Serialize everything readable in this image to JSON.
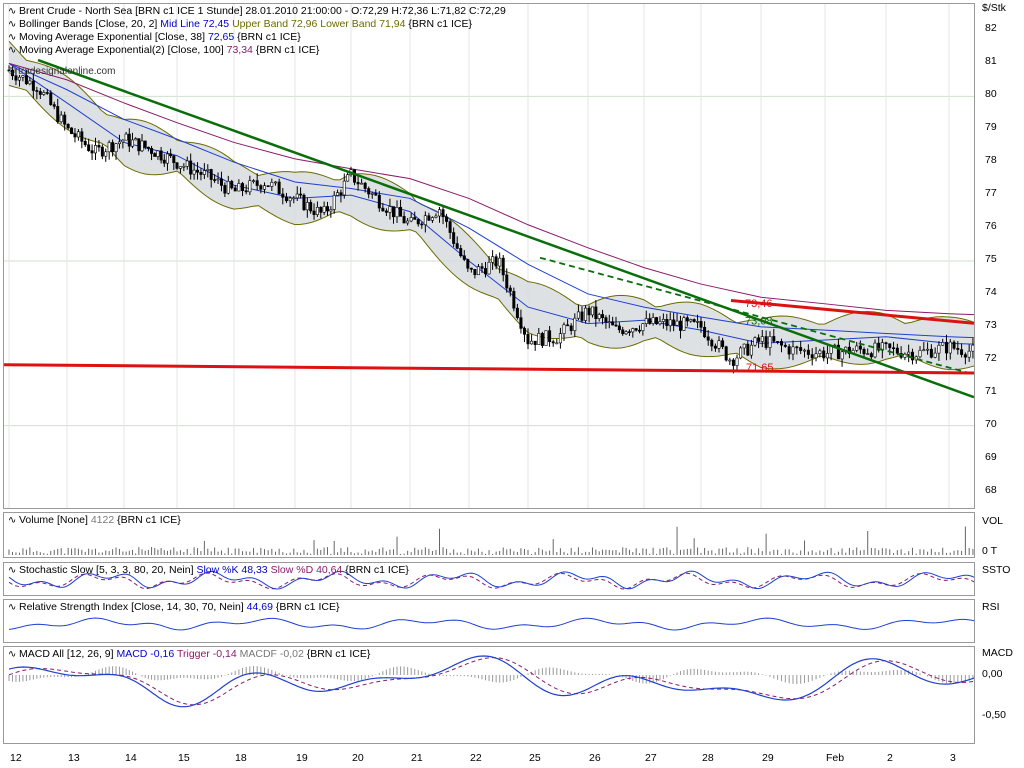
{
  "unit": "$/Stk",
  "main_legend": {
    "instrument": "Brent Crude - North Sea [BRN c1 ICE  1 Stunde] 28.01.2010 21:00:00 - O:72,29 H:72,36 L:71,82 C:72,29",
    "bollinger_prefix": "Bollinger Bands [Close, 20, 2]",
    "bollinger_mid": "Mid Line 72,45",
    "bollinger_upper": "Upper Band 72,96",
    "bollinger_lower": "Lower Band 71,94",
    "bollinger_suffix": "{BRN c1 ICE}",
    "ema1_prefix": "Moving Average Exponential [Close, 38]",
    "ema1_value": "72,65",
    "ema1_suffix": "{BRN c1 ICE}",
    "ema2_prefix": "Moving Average Exponential(2) [Close, 100]",
    "ema2_value": "73,34",
    "ema2_suffix": "{BRN c1 ICE}",
    "watermark": "© tradesignalonline.com"
  },
  "annotations": {
    "upper_label": "73,46",
    "ema_label": "73,08",
    "support_label": "71,65"
  },
  "y_ticks": [
    "82",
    "81",
    "80",
    "79",
    "78",
    "77",
    "76",
    "75",
    "74",
    "73",
    "72",
    "71",
    "70",
    "69",
    "68"
  ],
  "x_ticks": [
    "12",
    "13",
    "14",
    "15",
    "18",
    "19",
    "20",
    "21",
    "22",
    "25",
    "26",
    "27",
    "28",
    "29",
    "Feb",
    "2",
    "3"
  ],
  "volume": {
    "legend_prefix": "Volume [None]",
    "legend_value": "4122",
    "legend_suffix": "{BRN c1 ICE}",
    "axis_label": "VOL",
    "zero_label": "0 T"
  },
  "stochastic": {
    "legend_prefix": "Stochastic Slow [5, 3, 3, 80, 20, Nein]",
    "k": "Slow %K 48,33",
    "d": "Slow %D 40,64",
    "legend_suffix": "{BRN c1 ICE}",
    "axis_label": "SSTO"
  },
  "rsi": {
    "legend_prefix": "Relative Strength Index [Close, 14, 30, 70, Nein]",
    "legend_value": "44,69",
    "legend_suffix": "{BRN c1 ICE}",
    "axis_label": "RSI"
  },
  "macd": {
    "legend_prefix": "MACD All [12, 26, 9]",
    "macd": "MACD -0,16",
    "trigger": "Trigger -0,14",
    "macdf": "MACDF -0,02",
    "legend_suffix": "{BRN c1 ICE}",
    "axis_label": "MACD",
    "ticks": [
      "0,00",
      "-0,50"
    ]
  },
  "chart_data": {
    "type": "line",
    "title": "Brent Crude - North Sea [BRN c1 ICE  1 Stunde] 28.01.2010 21:00:00 - O:72,29 H:72,36 L:71,82 C:72,29",
    "ylabel": "$/Stk",
    "ylim": [
      67.5,
      82.5
    ],
    "x_categories": [
      "12",
      "13",
      "14",
      "15",
      "18",
      "19",
      "20",
      "21",
      "22",
      "25",
      "26",
      "27",
      "28",
      "29",
      "Feb",
      "2",
      "3"
    ],
    "series": [
      {
        "name": "Close",
        "x": [
          12.0,
          12.5,
          13.0,
          13.5,
          14.0,
          14.5,
          15.0,
          15.5,
          16.0,
          16.5,
          17.0,
          17.5,
          18.0,
          18.5,
          19.0,
          19.5,
          20.0,
          20.5,
          21.0,
          21.5,
          22.0,
          22.5,
          23.0,
          23.5,
          24.0,
          24.5,
          25.0,
          25.5,
          26.0,
          26.5,
          27.0,
          27.5,
          28.0,
          28.5,
          28.8
        ],
        "values": [
          80.8,
          80.3,
          79.0,
          78.3,
          78.7,
          78.4,
          78.0,
          77.6,
          77.1,
          77.4,
          76.9,
          76.4,
          77.6,
          76.8,
          76.1,
          76.6,
          74.6,
          75.0,
          72.6,
          72.7,
          73.5,
          72.9,
          73.1,
          73.1,
          73.0,
          72.0,
          72.6,
          72.3,
          72.2,
          72.3,
          72.3,
          72.2,
          72.4,
          72.2,
          72.3
        ]
      },
      {
        "name": "Mid Line",
        "x": [
          12.0,
          13.0,
          14.0,
          15.0,
          16.0,
          17.0,
          18.0,
          19.0,
          20.0,
          21.0,
          22.0,
          23.0,
          24.0,
          25.0,
          26.0,
          27.0,
          28.0,
          28.8
        ],
        "values": [
          81.0,
          79.8,
          78.6,
          78.2,
          77.3,
          76.9,
          77.0,
          76.5,
          75.0,
          73.6,
          73.1,
          73.2,
          72.9,
          72.5,
          72.6,
          72.7,
          72.5,
          72.45
        ]
      },
      {
        "name": "Moving Average Exponential",
        "x": [
          12.0,
          13.0,
          14.0,
          15.0,
          16.0,
          17.0,
          18.0,
          19.0,
          20.0,
          21.0,
          22.0,
          23.0,
          24.0,
          25.0,
          26.0,
          27.0,
          28.0,
          28.8
        ],
        "values": [
          81.0,
          80.2,
          79.3,
          78.7,
          78.0,
          77.4,
          77.2,
          76.9,
          76.0,
          74.9,
          74.0,
          73.6,
          73.3,
          73.0,
          72.9,
          72.8,
          72.7,
          72.65
        ]
      },
      {
        "name": "Moving Average Exponential(2)",
        "x": [
          12.0,
          13.0,
          14.0,
          15.0,
          16.0,
          17.0,
          18.0,
          19.0,
          20.0,
          21.0,
          22.0,
          23.0,
          24.0,
          25.0,
          26.0,
          27.0,
          28.0,
          28.8
        ],
        "values": [
          81.0,
          80.5,
          79.8,
          79.2,
          78.6,
          78.1,
          77.8,
          77.5,
          76.9,
          76.1,
          75.4,
          74.8,
          74.3,
          73.9,
          73.7,
          73.5,
          73.4,
          73.34
        ]
      }
    ],
    "trend_lines": [
      {
        "color": "#0a6e0a",
        "style": "solid",
        "from": [
          12.5,
          81.1
        ],
        "to": [
          31.5,
          70.45
        ]
      },
      {
        "color": "#0a6e0a",
        "style": "dashed",
        "from": [
          21.2,
          75.1
        ],
        "to": [
          31.5,
          71.25
        ]
      },
      {
        "color": "#dd1111",
        "style": "solid",
        "from": [
          11.5,
          71.85
        ],
        "to": [
          31.5,
          71.6
        ]
      },
      {
        "color": "#dd1111",
        "style": "solid",
        "from": [
          24.5,
          73.8
        ],
        "to": [
          31.5,
          73.0
        ]
      }
    ],
    "grid": false,
    "legend": "top-left"
  },
  "colors": {
    "mid": "#1f3fd0",
    "ema1": "#1f3fd0",
    "ema2": "#8b1a6b",
    "band": "#6b6b00",
    "band_fill": "#d6d9dd",
    "trend_green": "#0a6e0a",
    "trend_red": "#dd1111"
  }
}
